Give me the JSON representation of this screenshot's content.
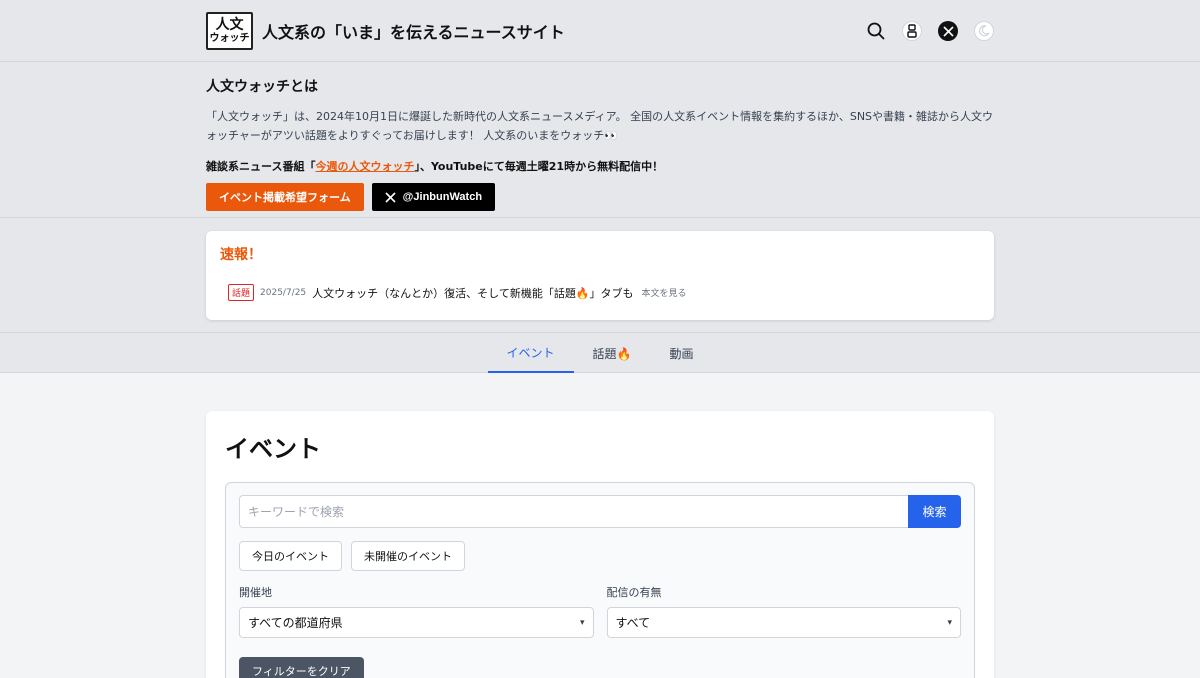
{
  "header": {
    "logo_line1": "人文",
    "logo_line2": "ウォッチ",
    "site_title": "人文系の「いま」を伝えるニュースサイト",
    "theme_icon_text": "☀"
  },
  "about": {
    "heading": "人文ウォッチとは",
    "description": "「人文ウォッチ」は、2024年10月1日に爆誕した新時代の人文系ニュースメディア。 全国の人文系イベント情報を集約するほか、SNSや書籍・雑誌から人文ウォッチャーがアツい話題をよりすぐってお届けします！ 人文系のいまをウォッチ👀",
    "show_prefix": "雑談系ニュース番組「",
    "show_link": "今週の人文ウォッチ",
    "show_suffix": "」、YouTubeにて毎週土曜21時から無料配信中！",
    "form_button": "イベント掲載希望フォーム",
    "x_button": "@JinbunWatch"
  },
  "breaking": {
    "heading": "速報！",
    "tag": "話題",
    "date": "2025/7/25",
    "title": "人文ウォッチ（なんとか）復活、そして新機能「話題🔥」タブも",
    "more": "本文を見る"
  },
  "tabs": [
    {
      "label": "イベント",
      "active": true
    },
    {
      "label": "話題🔥",
      "active": false
    },
    {
      "label": "動画",
      "active": false
    }
  ],
  "events": {
    "heading": "イベント",
    "search_placeholder": "キーワードで検索",
    "search_button": "検索",
    "chip_today": "今日のイベント",
    "chip_upcoming": "未開催のイベント",
    "location_label": "開催地",
    "location_value": "すべての都道府県",
    "stream_label": "配信の有無",
    "stream_value": "すべて",
    "clear_button": "フィルターをクリア"
  },
  "colors": {
    "accent_orange": "#ea580c",
    "accent_blue": "#2563eb",
    "tag_red": "#dc2626"
  }
}
